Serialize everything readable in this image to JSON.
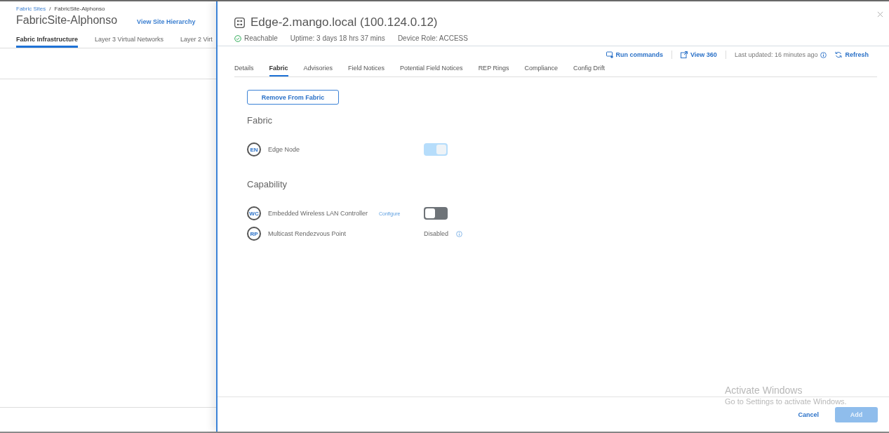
{
  "breadcrumb": {
    "items": [
      "Fabric Sites",
      "FabricSite-Alphonso"
    ],
    "separator": "/"
  },
  "site": {
    "title": "FabricSite-Alphonso",
    "hierarchy_link": "View Site Hierarchy"
  },
  "site_tabs": [
    {
      "label": "Fabric Infrastructure",
      "selected": true
    },
    {
      "label": "Layer 3 Virtual Networks",
      "selected": false
    },
    {
      "label": "Layer 2 Virt",
      "selected": false
    }
  ],
  "panel": {
    "device_title": "Edge-2.mango.local (100.124.0.12)",
    "status": {
      "label": "Reachable",
      "reachable": true
    },
    "uptime": "Uptime: 3 days 18 hrs 37 mins",
    "role": "Device Role: ACCESS",
    "actions": [
      {
        "kind": "commands",
        "label": "Run commands"
      },
      {
        "kind": "external",
        "label": "View 360"
      }
    ],
    "last_updated": "Last updated: 16 minutes ago",
    "refresh": "Refresh",
    "tabs": [
      {
        "label": "Details",
        "selected": false
      },
      {
        "label": "Fabric",
        "selected": true
      },
      {
        "label": "Advisories",
        "selected": false
      },
      {
        "label": "Field Notices",
        "selected": false
      },
      {
        "label": "Potential Field Notices",
        "selected": false
      },
      {
        "label": "REP Rings",
        "selected": false
      },
      {
        "label": "Compliance",
        "selected": false
      },
      {
        "label": "Config Drift",
        "selected": false
      }
    ],
    "remove_button": "Remove From Fabric",
    "sections": [
      {
        "heading": "Fabric",
        "rows": [
          {
            "kind": "toggle",
            "badge": "EN",
            "label": "Edge Node",
            "on": true,
            "disabled": true
          }
        ]
      },
      {
        "heading": "Capability",
        "rows": [
          {
            "kind": "toggle",
            "badge": "WC",
            "label": "Embedded Wireless LAN Controller",
            "link": "Configure",
            "on": false,
            "disabled": false
          },
          {
            "kind": "status",
            "badge": "RP",
            "label": "Multicast Rendezvous Point",
            "value": "Disabled"
          }
        ]
      }
    ],
    "footer": {
      "cancel": "Cancel",
      "add": {
        "label": "Add",
        "disabled": true
      }
    }
  },
  "os_watermark": {
    "title": "Activate Windows",
    "subtitle": "Go to Settings to activate Windows."
  }
}
